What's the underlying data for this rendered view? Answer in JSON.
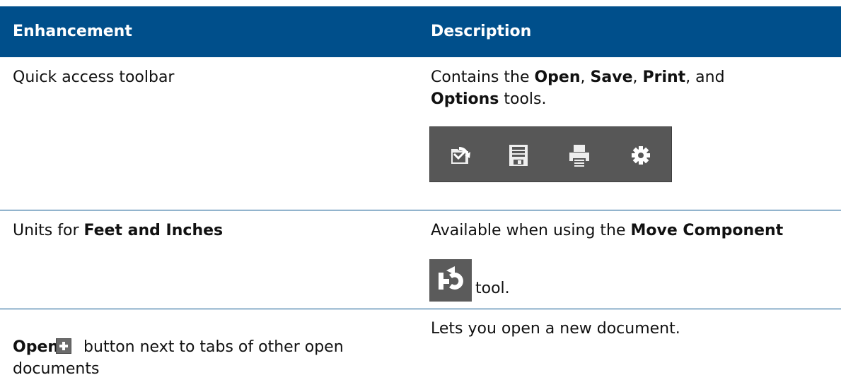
{
  "table": {
    "headers": {
      "enhancement": "Enhancement",
      "description": "Description"
    },
    "colors": {
      "header_bg": "#004F8B",
      "header_text": "#FFFFFF",
      "rule": "#004F8B",
      "toolbar_bg": "#575757"
    },
    "rows": [
      {
        "enhancement": "Quick access toolbar",
        "desc_parts": {
          "p1": "Contains the ",
          "b1": "Open",
          "p2": ", ",
          "b2": "Save",
          "p3": ", ",
          "b3": "Print",
          "p4": ", and",
          "b4": "Options",
          "p5": " tools."
        },
        "toolbar_icons": [
          "open-icon",
          "save-icon",
          "print-icon",
          "options-gear-icon"
        ]
      },
      {
        "enh_parts": {
          "p1": "Units for ",
          "b1": "Feet and Inches"
        },
        "desc_parts": {
          "p1": "Available when using the ",
          "b1": "Move Component",
          "p2": "tool."
        },
        "icon": "move-component-icon"
      },
      {
        "enh_parts": {
          "b1": "Open",
          "p1": " button next to tabs of other open",
          "p2": "documents"
        },
        "icon": "plus-icon",
        "description": "Lets you open a new document."
      }
    ]
  }
}
